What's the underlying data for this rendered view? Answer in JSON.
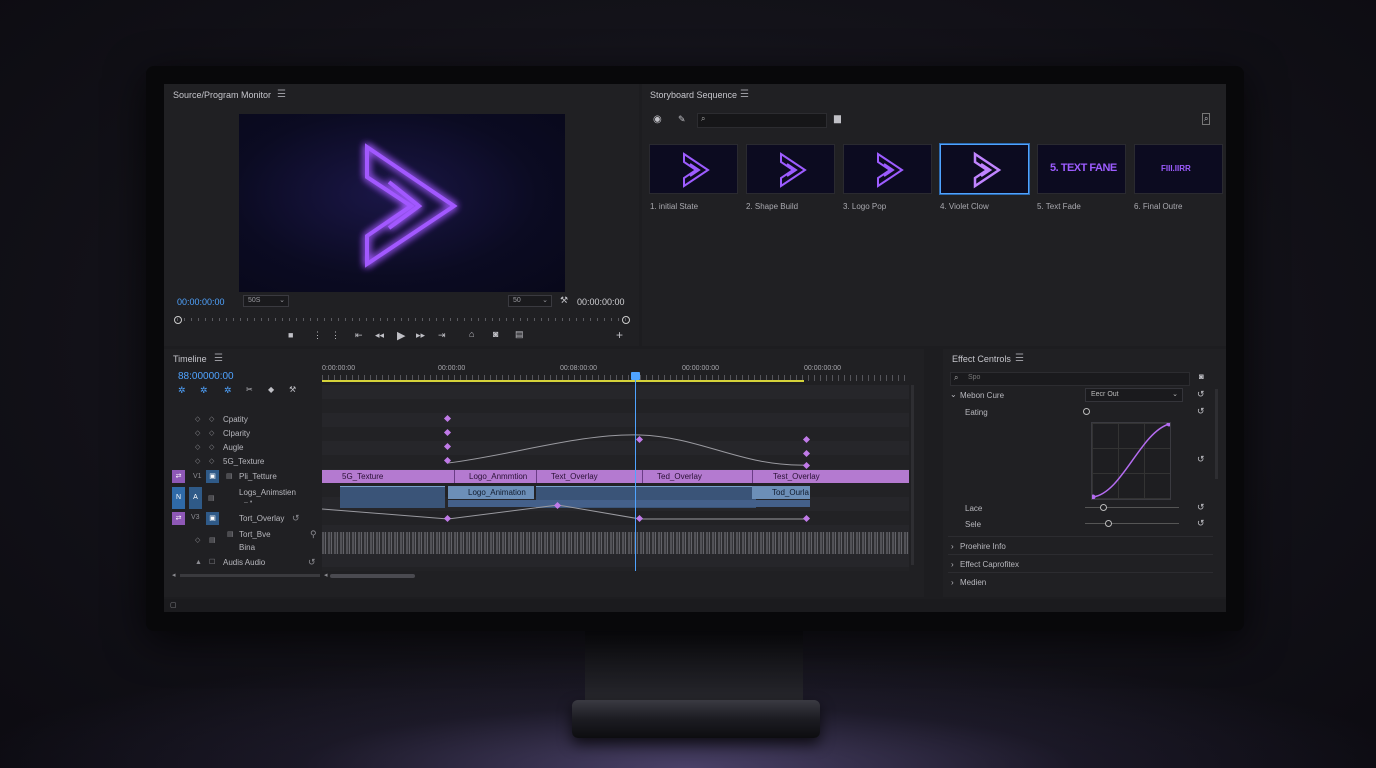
{
  "monitor": {
    "title": "Source/Program Monitor",
    "tc_left": "00:00:00:00",
    "select_left": "50S",
    "select_right": "50",
    "tc_right": "00:00:00:00"
  },
  "storyboard": {
    "title": "Storyboard Sequence",
    "search_placeholder": "",
    "frames": [
      {
        "label": "1. initial State",
        "text": ""
      },
      {
        "label": "2. Shape Build",
        "text": ""
      },
      {
        "label": "3. Logo Pop",
        "text": ""
      },
      {
        "label": "4. Violet Clow",
        "text": ""
      },
      {
        "label": "5. Text Fade",
        "text": "5. TEXT FANE"
      },
      {
        "label": "6. Final Outre",
        "text": "FIII.IIRR"
      }
    ]
  },
  "timeline": {
    "title": "Timeline",
    "timecode": "88:00000:00",
    "ruler": [
      "0:0:00:00",
      "00:00:00",
      "00:06:00:00",
      "00:00:00:00",
      "00:00:00:00"
    ],
    "ruler_visible": [
      "0:00:00:00",
      "00:00:00",
      "00:08:00:00",
      "00:00:00:00",
      "00:00:00:00"
    ],
    "props": [
      "Cpatity",
      "Clparity",
      "Augle",
      "5G_Texture"
    ],
    "tracks": {
      "v1_id": "V1",
      "v1_name": "Pli_Tetture",
      "logo_name": "Logs_Animstien",
      "v3_id": "V3",
      "v3_name": "Tort_Overlay",
      "audio_name_1": "Tort_Bve",
      "audio_name_2": "Bina",
      "audio_label": "Audis Audio"
    },
    "clips_top": [
      "5G_Texture",
      "Logo_Anmmtion",
      "Text_Overlay",
      "Ted_Overlay",
      "Test_Overlay"
    ],
    "clips_mid": [
      "Logo_Animation",
      "Tod_Ourla"
    ]
  },
  "effects": {
    "title": "Effect Centrols",
    "search_placeholder": "Spo",
    "motion_label": "Mebon Cure",
    "easing_select": "Eecr Out",
    "easing_label": "Eating",
    "lace_label": "Lace",
    "sele_label": "Sele",
    "sections": [
      "Proehire Info",
      "Effect Caprofitex",
      "Medien"
    ]
  },
  "colors": {
    "accent_blue": "#4fa3ff",
    "accent_purple": "#a259ff",
    "clip_purple": "#b47ad0",
    "clip_blue": "#6c8fb8"
  }
}
